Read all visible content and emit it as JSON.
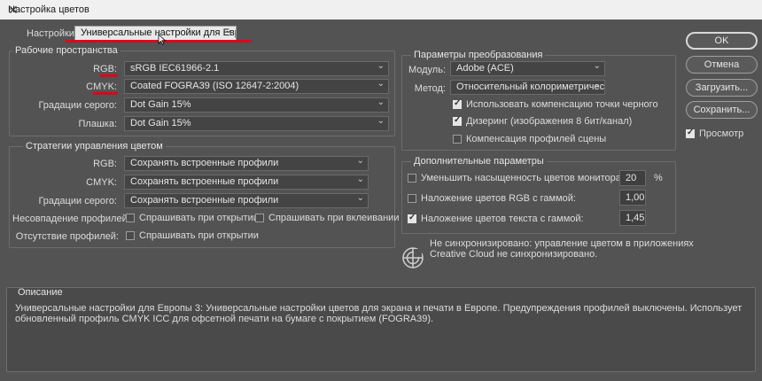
{
  "window": {
    "title": "Настройка цветов",
    "close_glyph": "✕"
  },
  "settings": {
    "label": "Настройки:",
    "value": "Универсальные настройки для Европ..."
  },
  "workspaces": {
    "title": "Рабочие пространства",
    "rgb_label": "RGB:",
    "rgb_value": "sRGB IEC61966-2.1",
    "cmyk_label": "CMYK:",
    "cmyk_value": "Coated FOGRA39 (ISO 12647-2:2004)",
    "gray_label": "Градации серого:",
    "gray_value": "Dot Gain 15%",
    "spot_label": "Плашка:",
    "spot_value": "Dot Gain 15%"
  },
  "policies": {
    "title": "Стратегии управления цветом",
    "rgb_label": "RGB:",
    "rgb_value": "Сохранять встроенные профили",
    "cmyk_label": "CMYK:",
    "cmyk_value": "Сохранять встроенные профили",
    "gray_label": "Градации серого:",
    "gray_value": "Сохранять встроенные профили",
    "mismatch_label": "Несовпадение профилей:",
    "ask_open": "Спрашивать при открытии",
    "ask_paste": "Спрашивать при вклеивании",
    "missing_label": "Отсутствие профилей:",
    "ask_open2": "Спрашивать при открытии"
  },
  "conversion": {
    "title": "Параметры преобразования",
    "engine_label": "Модуль:",
    "engine_value": "Adobe (ACE)",
    "intent_label": "Метод:",
    "intent_value": "Относительный колориметрический",
    "bpc": "Использовать компенсацию точки черного",
    "dither": "Дизеринг (изображения 8 бит/канал)",
    "scene": "Компенсация профилей сцены"
  },
  "advanced": {
    "title": "Дополнительные параметры",
    "desaturate": "Уменьшить насыщенность цветов монитора на:",
    "desaturate_value": "20",
    "percent": "%",
    "blend_rgb": "Наложение цветов RGB с гаммой:",
    "blend_rgb_value": "1,00",
    "blend_text": "Наложение цветов текста с гаммой:",
    "blend_text_value": "1,45"
  },
  "sync": {
    "line1": "Не синхронизировано: управление цветом в приложениях",
    "line2": "Creative Cloud не синхронизировано."
  },
  "description": {
    "title": "Описание",
    "line1": "Универсальные настройки для Европы 3:  Универсальные настройки цветов для экрана и печати в Европе. Предупреждения профилей выключены. Использует",
    "line2": "обновленный профиль CMYK ICC для офсетной печати на бумаге с покрытием (FOGRA39)."
  },
  "buttons": {
    "ok": "OK",
    "cancel": "Отмена",
    "load": "Загрузить...",
    "save": "Сохранить...",
    "preview": "Просмотр"
  },
  "colors": {
    "background": "#535353",
    "annotation_red": "#e1001a"
  }
}
